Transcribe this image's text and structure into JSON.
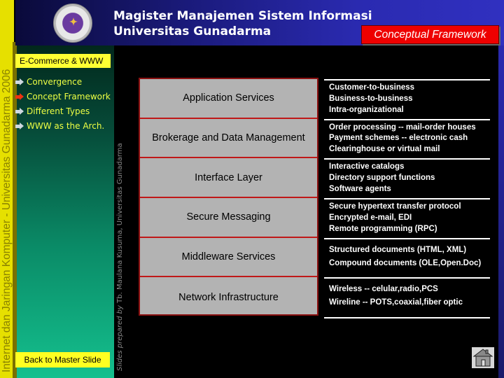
{
  "side_strip": {
    "text": "Internet dan Jaringan Komputer - Universitas Gunadarma 2006"
  },
  "header": {
    "title_line1": "Magister Manajemen Sistem Informasi",
    "title_line2": "Universitas Gunadarma",
    "badge": "Conceptual Framework",
    "logo_icon": "university-logo"
  },
  "nav": {
    "section": "E-Commerce & WWW",
    "items": [
      {
        "label": "Convergence",
        "icon": "arrow-right-icon",
        "active": false,
        "color": "#d0d8e0"
      },
      {
        "label": "Concept Framework",
        "icon": "arrow-right-icon",
        "active": true,
        "color": "#ee3311"
      },
      {
        "label": "Different Types",
        "icon": "arrow-right-icon",
        "active": false,
        "color": "#d0d8e0"
      },
      {
        "label": "WWW as the Arch.",
        "icon": "arrow-right-icon",
        "active": false,
        "color": "#d0d8e0"
      }
    ],
    "back_button": "Back to Master Slide"
  },
  "credits": {
    "prefix": "Slides prepared by",
    "author": "Tb. Maulana Kusuma, Universitas Gunadarma"
  },
  "layers": [
    {
      "name": "Application Services",
      "lines": [
        "Customer-to-business",
        "Business-to-business",
        "Intra-organizational"
      ]
    },
    {
      "name": "Brokerage and Data Management",
      "lines": [
        "Order processing -- mail-order houses",
        "Payment schemes -- electronic cash",
        "Clearinghouse or virtual mail"
      ]
    },
    {
      "name": "Interface Layer",
      "lines": [
        "Interactive catalogs",
        "Directory support functions",
        "Software agents"
      ]
    },
    {
      "name": "Secure Messaging",
      "lines": [
        "Secure hypertext transfer protocol",
        "Encrypted e-mail, EDI",
        "Remote programming (RPC)"
      ]
    },
    {
      "name": "Middleware Services",
      "lines": [
        "Structured documents (HTML, XML)",
        "Compound documents (OLE,Open.Doc)"
      ]
    },
    {
      "name": "Network Infrastructure",
      "lines": [
        "Wireless -- celular,radio,PCS",
        "Wireline -- POTS,coaxial,fiber optic"
      ]
    }
  ],
  "home_button": {
    "icon": "home-icon"
  },
  "colors": {
    "badge": "#ee0000",
    "tag": "#ffff33",
    "nav_text": "#eeff44",
    "layer_bg": "#b3b3b3",
    "layer_border": "#c01818"
  }
}
